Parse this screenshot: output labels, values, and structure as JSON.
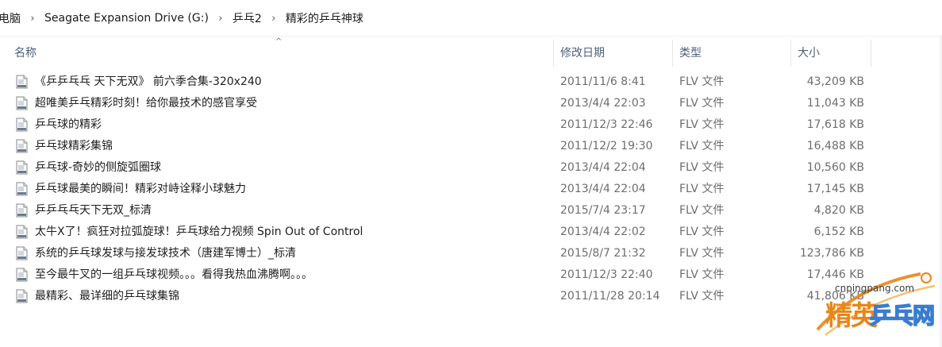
{
  "breadcrumb": {
    "items": [
      "电脑",
      "Seagate Expansion Drive (G:)",
      "乒乓2",
      "精彩的乒乓神球"
    ]
  },
  "columns": {
    "name": "名称",
    "date": "修改日期",
    "type": "类型",
    "size": "大小"
  },
  "files": [
    {
      "name": "《乒乒乓乓 天下无双》 前六季合集-320x240",
      "date": "2011/11/6 8:41",
      "type": "FLV 文件",
      "size": "43,209 KB"
    },
    {
      "name": "超唯美乒乓精彩时刻！给你最技术的感官享受",
      "date": "2013/4/4 22:03",
      "type": "FLV 文件",
      "size": "11,043 KB"
    },
    {
      "name": "乒乓球的精彩",
      "date": "2011/12/3 22:46",
      "type": "FLV 文件",
      "size": "17,618 KB"
    },
    {
      "name": "乒乓球精彩集锦",
      "date": "2011/12/2 19:30",
      "type": "FLV 文件",
      "size": "16,488 KB"
    },
    {
      "name": "乒乓球-奇妙的侧旋弧圈球",
      "date": "2013/4/4 22:04",
      "type": "FLV 文件",
      "size": "10,560 KB"
    },
    {
      "name": "乒乓球最美的瞬间！精彩对峙诠释小球魅力",
      "date": "2013/4/4 22:04",
      "type": "FLV 文件",
      "size": "17,145 KB"
    },
    {
      "name": "乒乒乓乓天下无双_标清",
      "date": "2015/7/4 23:17",
      "type": "FLV 文件",
      "size": "4,820 KB"
    },
    {
      "name": "太牛X了！疯狂对拉弧旋球！乒乓球给力视频 Spin Out of Control",
      "date": "2013/4/4 22:02",
      "type": "FLV 文件",
      "size": "6,152 KB"
    },
    {
      "name": "系统的乒乓球发球与接发球技术（唐建军博士）_标清",
      "date": "2015/8/7 21:32",
      "type": "FLV 文件",
      "size": "123,786 KB"
    },
    {
      "name": "至今最牛叉的一组乒乓球视频。。。看得我热血沸腾啊。。。",
      "date": "2011/12/3 22:40",
      "type": "FLV 文件",
      "size": "17,446 KB"
    },
    {
      "name": "最精彩、最详细的乒乓球集锦",
      "date": "2011/11/28 20:14",
      "type": "FLV 文件",
      "size": "41,806 KB"
    }
  ],
  "watermark": {
    "url": "cnpingpang.com",
    "brand_a": "精英",
    "brand_b": "乒乓网"
  },
  "colors": {
    "header_text": "#4c607a",
    "meta_text": "#6d6d6d",
    "brand_orange": "#e8861a",
    "brand_blue": "#3a7ccf"
  },
  "icons": {
    "file": "flash-video-file-icon",
    "separator": "chevron-right-icon",
    "sort": "sort-ascending-icon"
  }
}
